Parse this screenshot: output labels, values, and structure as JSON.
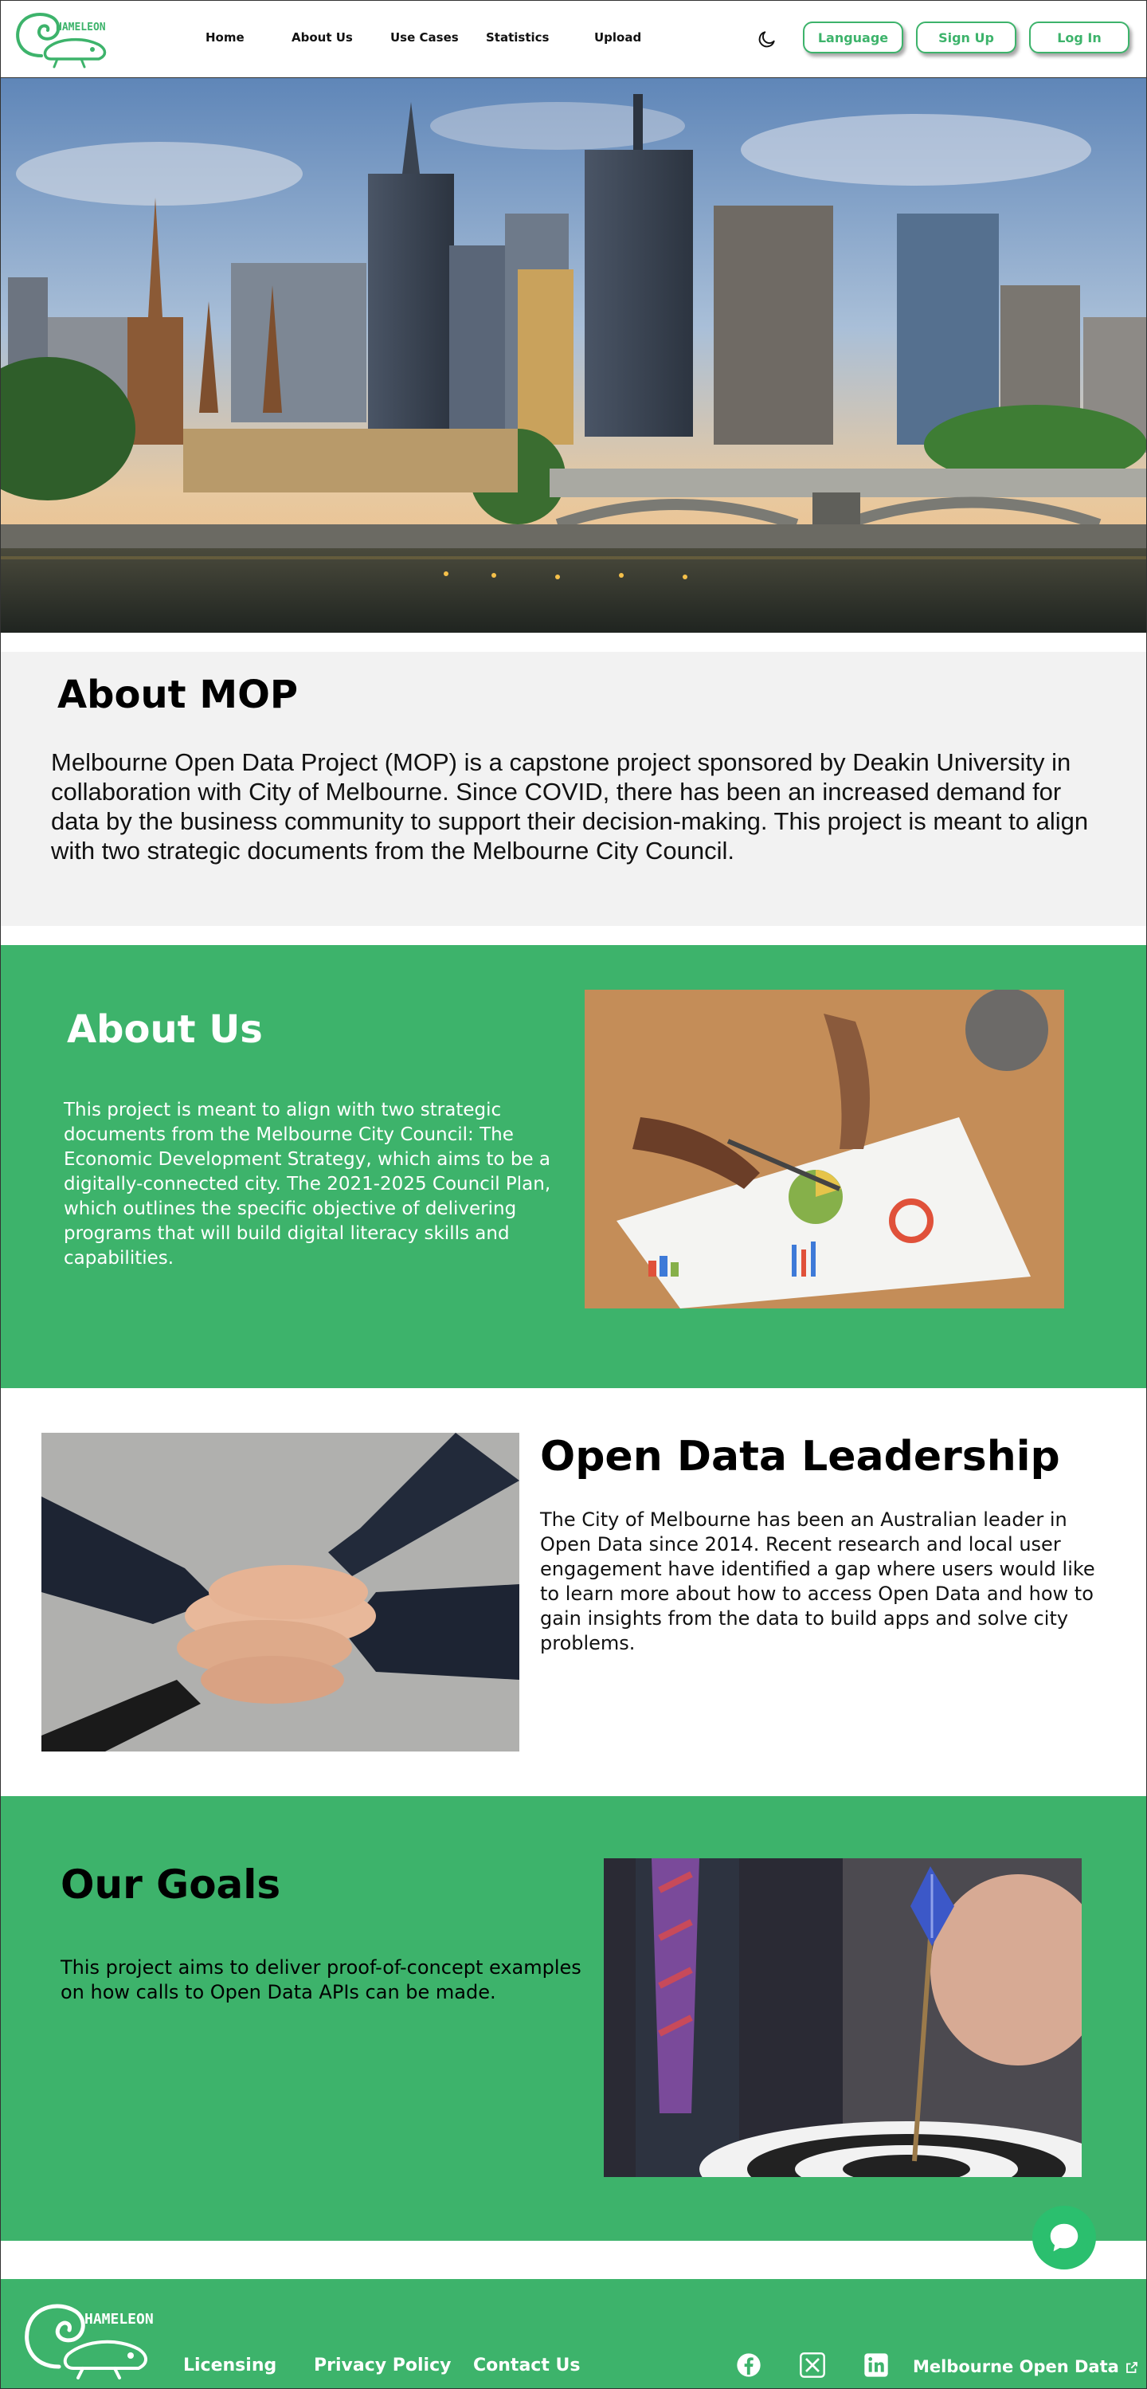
{
  "header": {
    "logo_text": "HAMELEON",
    "nav": [
      "Home",
      "About Us",
      "Use Cases",
      "Statistics",
      "Upload"
    ],
    "theme_icon": "moon-icon",
    "buttons": {
      "language": "Language",
      "signup": "Sign Up",
      "login": "Log In"
    }
  },
  "about_mop": {
    "title": "About MOP",
    "body": "Melbourne Open Data Project (MOP) is a capstone project sponsored by Deakin University in collaboration with City of Melbourne. Since COVID, there has been an increased demand for data by the business community to support their decision-making. This project is meant to align with two strategic documents from the Melbourne City Council."
  },
  "about_us": {
    "title": "About Us",
    "body": "This project is meant to align with two strategic documents from the Melbourne City Council: The Economic Development Strategy, which aims to be a digitally-connected city. The 2021-2025 Council Plan, which outlines the specific objective of delivering programs that will build digital literacy skills and capabilities."
  },
  "leadership": {
    "title": "Open Data Leadership",
    "body": "The City of Melbourne has been an Australian leader in Open Data since 2014. Recent research and local user engagement have identified a gap where users would like to learn more about how to access Open Data and how to gain insights from the data to build apps and solve city problems."
  },
  "goals": {
    "title": "Our Goals",
    "body": "This project aims to deliver proof-of-concept examples on how calls to Open Data APIs can be made."
  },
  "footer": {
    "logo_text": "HAMELEON",
    "links": [
      "Licensing",
      "Privacy Policy",
      "Contact Us"
    ],
    "social_icons": [
      "facebook-icon",
      "x-twitter-icon",
      "linkedin-icon"
    ],
    "external_link": "Melbourne Open Data"
  },
  "colors": {
    "brand_green": "#3db36b",
    "chat_green": "#2bbf6e",
    "light_gray": "#f2f2f2"
  }
}
